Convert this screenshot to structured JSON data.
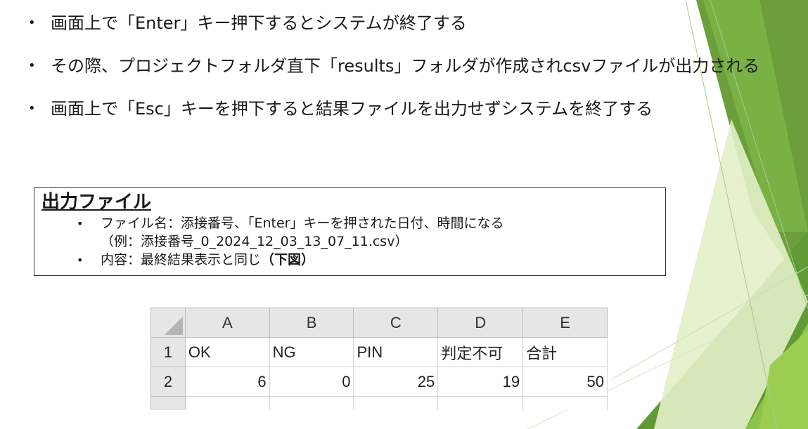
{
  "bullets": [
    {
      "text": "画面上で「Enter」キー押下するとシステムが終了する"
    },
    {
      "text": "その際、プロジェクトフォルダ直下「results」フォルダが作成されcsvファイルが出力される"
    },
    {
      "text": "画面上で「Esc」キーを押下すると結果ファイルを出力せずシステムを終了する"
    }
  ],
  "bullet_glyph": "•",
  "output_box": {
    "title": "出力ファイル",
    "line1": "ファイル名：添接番号、「Enter」キーを押された日付、時間になる",
    "line2": "（例：添接番号_0_2024_12_03_13_07_11.csv）",
    "line3_prefix": "内容：最終結果表示と同じ",
    "line3_bold": "（下図）"
  },
  "spreadsheet": {
    "columns": [
      "A",
      "B",
      "C",
      "D",
      "E"
    ],
    "rows": [
      {
        "num": "1",
        "cells": [
          "OK",
          "NG",
          "PIN",
          "判定不可",
          "合計"
        ]
      },
      {
        "num": "2",
        "cells": [
          "6",
          "0",
          "25",
          "19",
          "50"
        ]
      }
    ]
  },
  "colors": {
    "accent_dark": "#5f9a34",
    "accent_mid": "#76b041",
    "accent_light": "#cde4a8"
  }
}
